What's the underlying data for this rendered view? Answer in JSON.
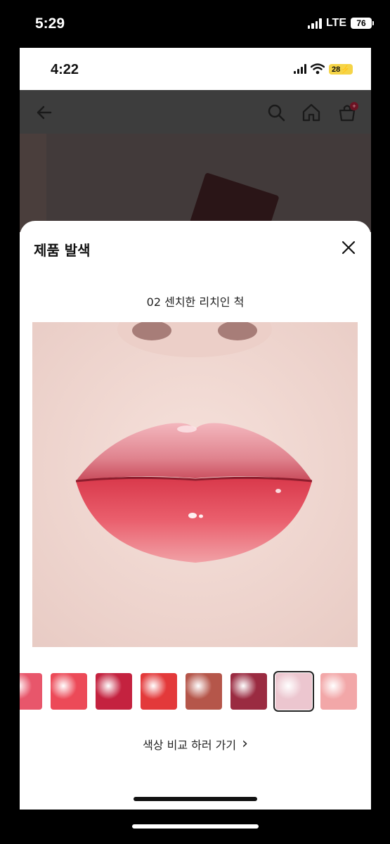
{
  "outer_status": {
    "time": "5:29",
    "network": "LTE",
    "battery": "76"
  },
  "inner_status": {
    "time": "4:22",
    "battery": "28"
  },
  "header": {
    "icons": [
      "back-arrow-icon",
      "search-icon",
      "home-icon",
      "cart-icon"
    ]
  },
  "sheet": {
    "title": "제품 발색",
    "close_icon": "close-icon",
    "selected_shade": "02 센치한 리치인 척",
    "compare_link": "색상 비교 하러 가기",
    "compare_chevron": "›",
    "swatches": [
      {
        "color": "#e8566b",
        "selected": false
      },
      {
        "color": "#ec4a58",
        "selected": false
      },
      {
        "color": "#c4223f",
        "selected": false
      },
      {
        "color": "#e3393a",
        "selected": false
      },
      {
        "color": "#b5564a",
        "selected": false
      },
      {
        "color": "#9a2b41",
        "selected": false
      },
      {
        "color": "#ecc6cf",
        "selected": true
      },
      {
        "color": "#f2a7a8",
        "selected": false
      }
    ]
  },
  "colors": {
    "dim_overlay": "#3d3d3d",
    "cart_badge": "#c51b3a"
  }
}
